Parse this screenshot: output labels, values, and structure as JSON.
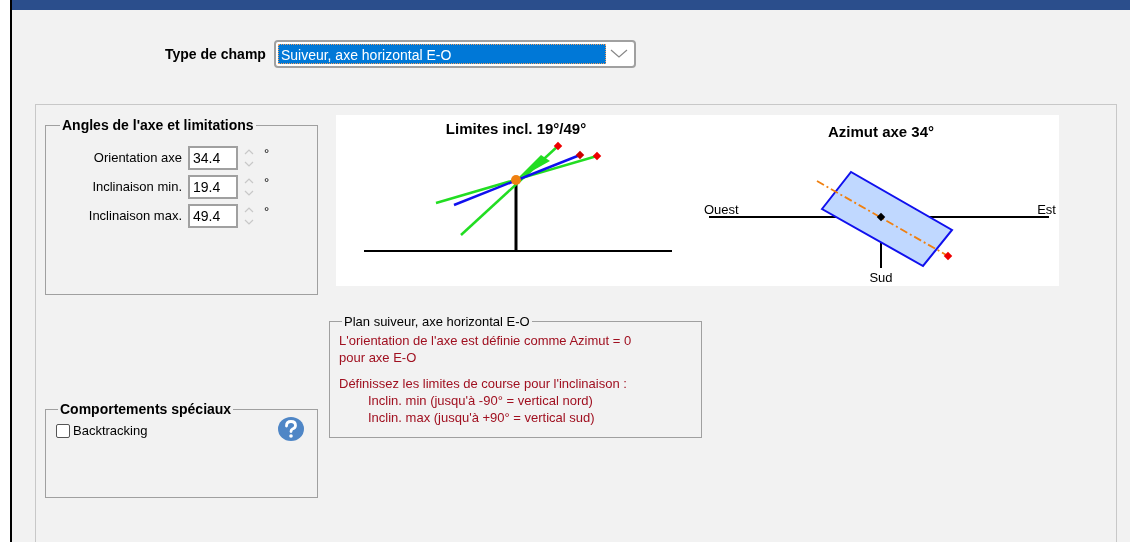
{
  "field_type": {
    "label": "Type de champ",
    "value": "Suiveur, axe horizontal E-O"
  },
  "axis_angles": {
    "title": "Angles de l'axe et limitations",
    "fields": [
      {
        "label": "Orientation axe",
        "value": "34.4",
        "unit": "°"
      },
      {
        "label": "Inclinaison min.",
        "value": "19.4",
        "unit": "°"
      },
      {
        "label": "Inclinaison max.",
        "value": "49.4",
        "unit": "°"
      }
    ]
  },
  "diagrams": {
    "tilt": {
      "title": "Limites incl. 19°/49°"
    },
    "azimuth": {
      "title": "Azimut axe 34°",
      "west": "Ouest",
      "east": "Est",
      "south": "Sud"
    }
  },
  "info": {
    "title": "Plan suiveur, axe horizontal E-O",
    "lines": [
      {
        "kind": "paragraph",
        "text": "L'orientation de l'axe est définie comme Azimut = 0 pour axe E-O"
      },
      {
        "kind": "paragraph",
        "text": "Définissez les limites de course pour l'inclinaison :"
      },
      {
        "kind": "indented",
        "text": "Inclin. min (jusqu'à -90° = vertical nord)"
      },
      {
        "kind": "indented",
        "text": "Inclin. max (jusqu'à +90° = vertical sud)"
      }
    ]
  },
  "special": {
    "title": "Comportements spéciaux",
    "backtracking": {
      "label": "Backtracking",
      "checked": false
    }
  }
}
